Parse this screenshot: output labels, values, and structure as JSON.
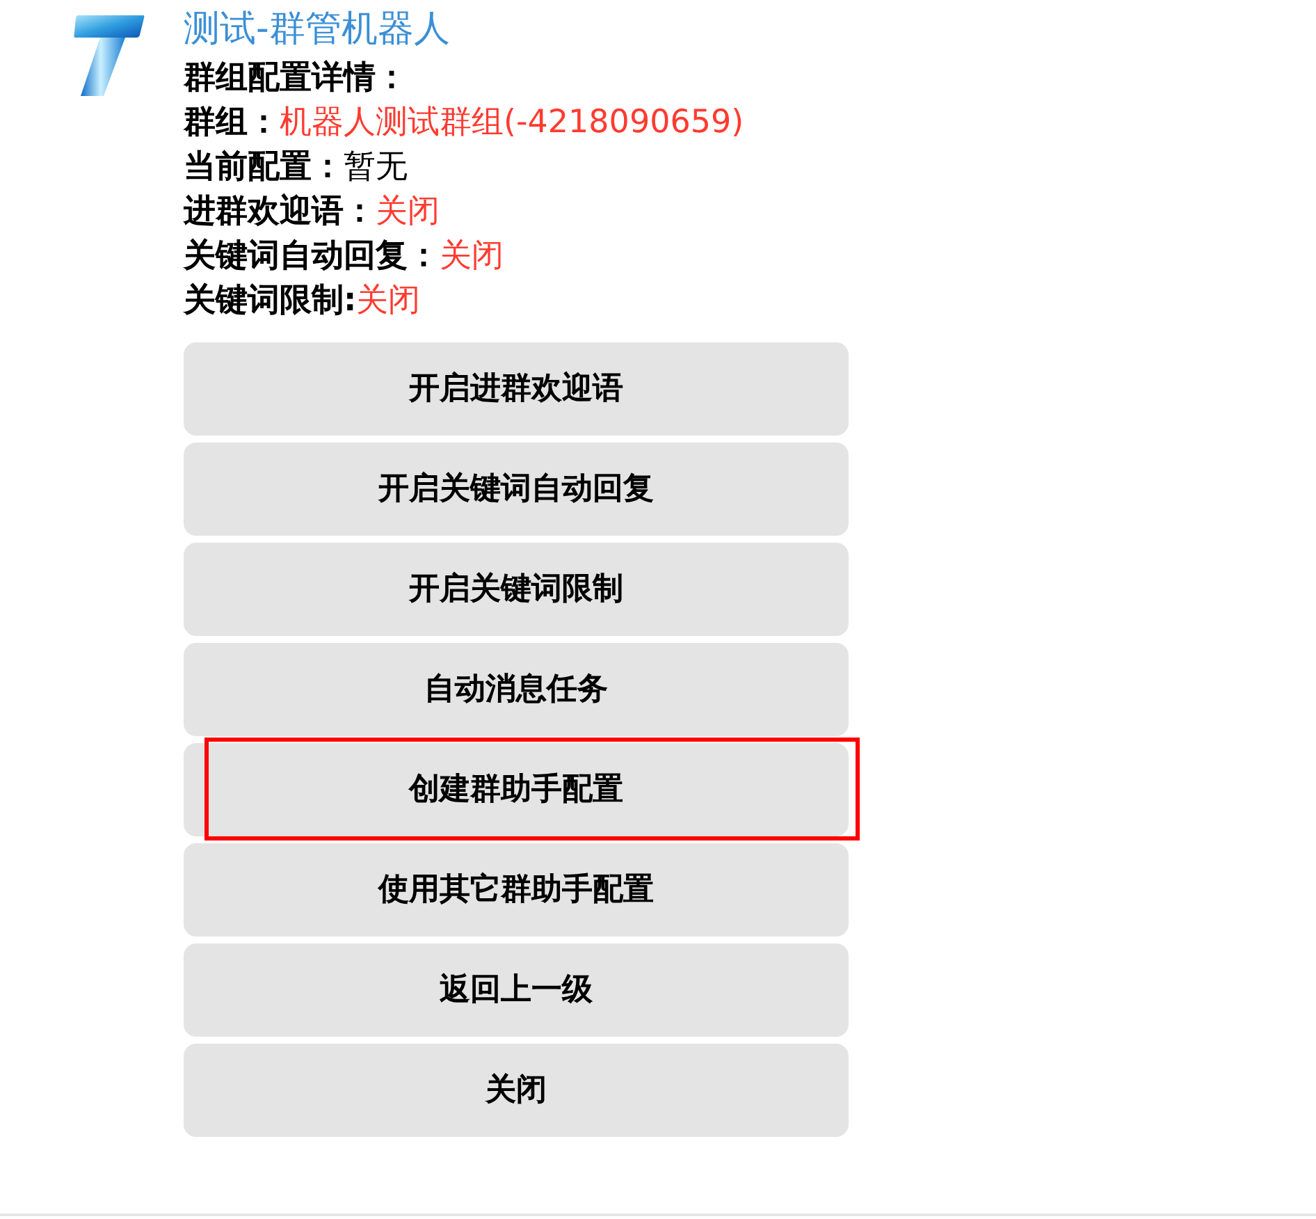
{
  "bot": {
    "name": "测试-群管机器人"
  },
  "details": {
    "heading": "群组配置详情：",
    "rows": [
      {
        "label": "群组：",
        "value": "机器人测试群组(-4218090659)",
        "color": "#ff3b30"
      },
      {
        "label": "当前配置：",
        "value": "暂无",
        "color": "#000000"
      },
      {
        "label": "进群欢迎语：",
        "value": "关闭",
        "color": "#ff3b30"
      },
      {
        "label": "关键词自动回复：",
        "value": "关闭",
        "color": "#ff3b30"
      },
      {
        "label": "关键词限制:",
        "value": "关闭",
        "color": "#ff3b30"
      }
    ]
  },
  "buttons": [
    {
      "label": "开启进群欢迎语",
      "highlighted": false
    },
    {
      "label": "开启关键词自动回复",
      "highlighted": false
    },
    {
      "label": "开启关键词限制",
      "highlighted": false
    },
    {
      "label": "自动消息任务",
      "highlighted": false
    },
    {
      "label": "创建群助手配置",
      "highlighted": true
    },
    {
      "label": "使用其它群助手配置",
      "highlighted": false
    },
    {
      "label": "返回上一级",
      "highlighted": false
    },
    {
      "label": "关闭",
      "highlighted": false
    }
  ]
}
